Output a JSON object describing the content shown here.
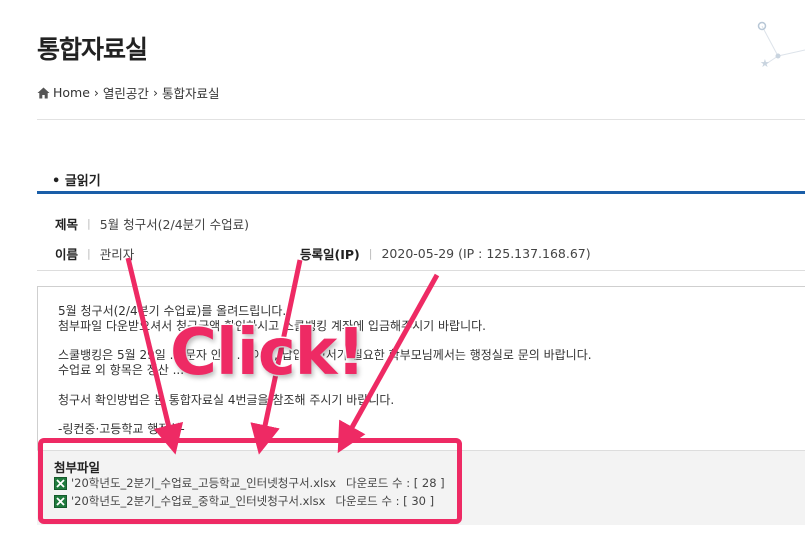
{
  "page": {
    "title": "통합자료실"
  },
  "breadcrumb": {
    "home": "Home",
    "level1": "열린공간",
    "level2": "통합자료실"
  },
  "section": {
    "title": "• 글읽기"
  },
  "post": {
    "subject_label": "제목",
    "subject": "5월 청구서(2/4분기 수업료)",
    "name_label": "이름",
    "name": "관리자",
    "date_label": "등록일(IP)",
    "date": "2020-05-29 (IP : 125.137.168.67)"
  },
  "body_lines": [
    "5월 청구서(2/4분기 수업료)를 올려드립니다.",
    "첨부파일 다운받으셔서 청구금액 확인하시고 스쿨뱅킹 계좌에 입금해주시기 바랍니다.",
    "스쿨뱅킹은 5월 29일 ... 문자 안내 ... 이며, 납입증명서가 필요한 학부모님께서는 행정실로 문의 바랍니다.",
    "수업료 외 항목은 정산 ...",
    "청구서 확인방법은 본 통합자료실 4번글을 참조해 주시기 바랍니다.",
    "-링컨중·고등학교 행정실-"
  ],
  "attachments": {
    "title": "첨부파일",
    "files": [
      {
        "name": "'20학년도_2분기_수업료_고등학교_인터넷청구서.xlsx",
        "downloads": "다운로드 수 : [ 28 ]",
        "icon": "excel-file-icon"
      },
      {
        "name": "'20학년도_2분기_수업료_중학교_인터넷청구서.xlsx",
        "downloads": "다운로드 수 : [ 30 ]",
        "icon": "excel-file-icon"
      }
    ]
  },
  "overlay": {
    "text": "Click!",
    "color": "#ee2a64"
  },
  "colors": {
    "accent_bar": "#1a5ea8",
    "highlight": "#ee2a64"
  }
}
